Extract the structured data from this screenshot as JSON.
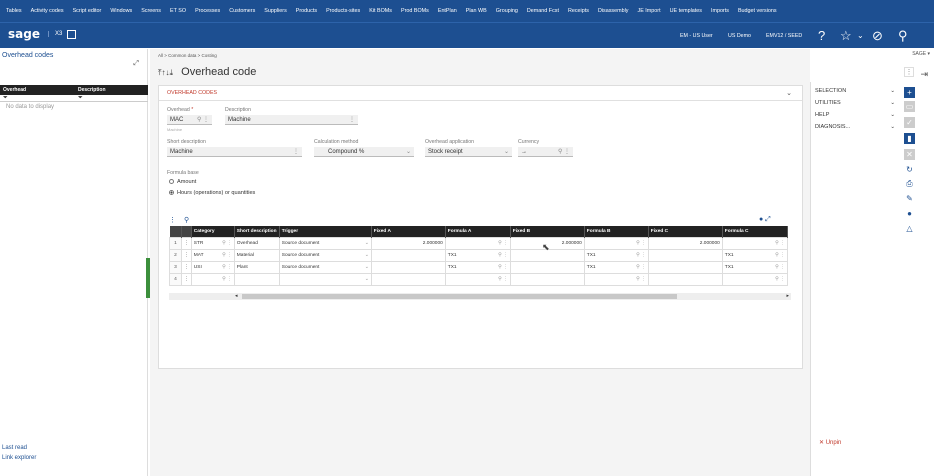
{
  "topnav": [
    "Tables",
    "Activity codes",
    "Script editor",
    "Windows",
    "Screens",
    "ET SO",
    "Processes",
    "Customers",
    "Suppliers",
    "Products",
    "Products-sites",
    "Kit BOMs",
    "Prod BOMs",
    "EntPlan",
    "Plan WB",
    "Grouping",
    "Demand Fcst",
    "Receipts",
    "Disassembly",
    "JE Import",
    "UE templates",
    "Imports",
    "Budget versions"
  ],
  "header": {
    "logo": "sage",
    "app": "X3",
    "user": "EM - US User",
    "company": "US Demo",
    "folder": "EMV12 / SEED"
  },
  "left": {
    "title": "Overhead codes",
    "col1": "Overhead",
    "col2": "Description",
    "nodata": "No data to display",
    "foot1": "Last read",
    "foot2": "Link explorer"
  },
  "breadcrumb": "All  >  Common data  >  Costing",
  "page_title": "Overhead code",
  "sage_label": "SAGE",
  "section_title": "OVERHEAD CODES",
  "form": {
    "overhead_label": "Overhead",
    "overhead_value": "MAC",
    "overhead_sub": "Machine",
    "desc_label": "Description",
    "desc_value": "Machine",
    "short_label": "Short description",
    "short_value": "Machine",
    "calc_label": "Calculation method",
    "calc_value": "Compound %",
    "app_label": "Overhead application",
    "app_value": "Stock receipt",
    "cur_label": "Currency",
    "cur_value": "→",
    "fb_label": "Formula base",
    "opt1": "Amount",
    "opt2": "Hours (operations) or quantities"
  },
  "grid": {
    "headers": [
      "Category",
      "Short description",
      "Trigger",
      "Fixed A",
      "Formula A",
      "Fixed B",
      "Formula B",
      "Fixed C",
      "Formula C"
    ],
    "rows": [
      {
        "n": "1",
        "cat": "STR",
        "short": "Overhead",
        "trig": "Source document",
        "fa": "2.000000",
        "fma": "",
        "fb": "2.000000",
        "fmb": "",
        "fc": "2.000000",
        "fmc": ""
      },
      {
        "n": "2",
        "cat": "MAT",
        "short": "Material",
        "trig": "Source document",
        "fa": "",
        "fma": "TX1",
        "fb": "",
        "fmb": "TX1",
        "fc": "",
        "fmc": "TX1"
      },
      {
        "n": "3",
        "cat": "USI",
        "short": "Plant",
        "trig": "Source document",
        "fa": "",
        "fma": "TX1",
        "fb": "",
        "fmb": "TX1",
        "fc": "",
        "fmc": "TX1"
      },
      {
        "n": "4",
        "cat": "",
        "short": "",
        "trig": "",
        "fa": "",
        "fma": "",
        "fb": "",
        "fmb": "",
        "fc": "",
        "fmc": ""
      }
    ]
  },
  "right": {
    "items": [
      "SELECTION",
      "UTILITIES",
      "HELP",
      "DIAGNOSIS..."
    ],
    "unpin": "Unpin"
  },
  "colors": {
    "nav": "#1d4f91",
    "accent": "#c0392b",
    "green": "#3c8f3c"
  }
}
